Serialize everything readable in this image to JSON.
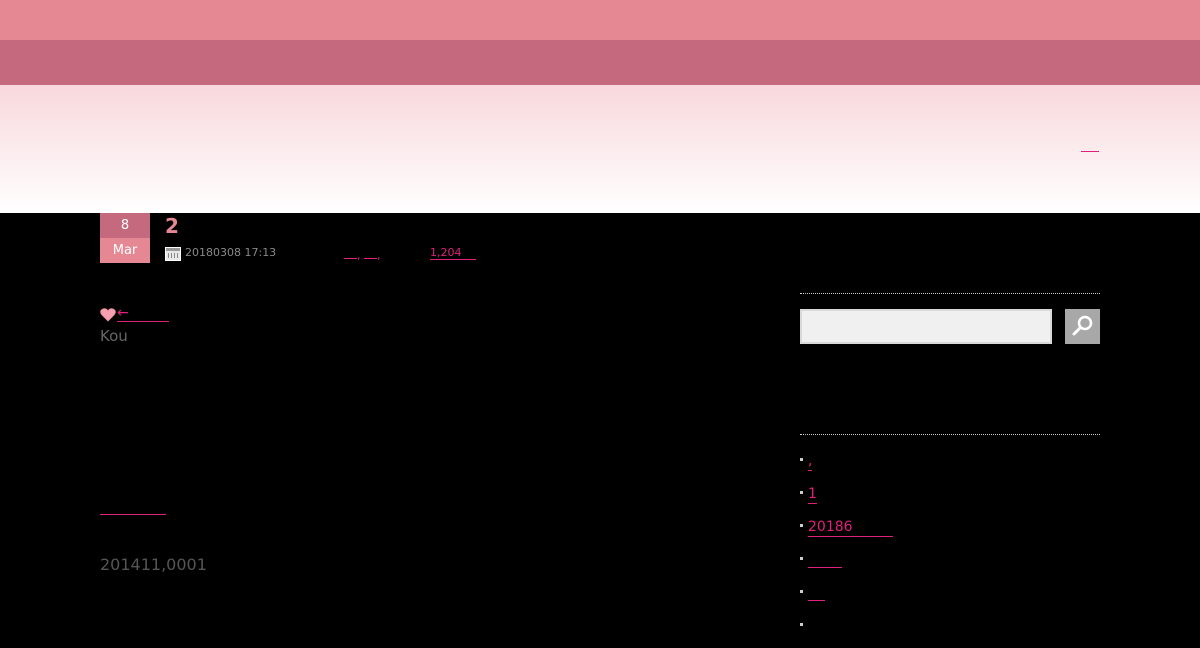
{
  "header": {
    "hero_link": ""
  },
  "post": {
    "day": "8",
    "month": "Mar",
    "title": "2",
    "date": "20180308 17:13",
    "categories": [
      "",
      ""
    ],
    "views": "1,204",
    "back_link": "←",
    "author": "Kou",
    "body_link": "",
    "footer_number": "201411,0001"
  },
  "sidebar": {
    "search": {
      "placeholder": "",
      "value": ""
    },
    "links": [
      ",",
      "1",
      "20186",
      "",
      "",
      ""
    ]
  },
  "colors": {
    "topbar": "#e68894",
    "navbar": "#c5697f",
    "accent_link": "#e0207a",
    "background": "#000000"
  },
  "icons": {
    "date": "calendar-icon",
    "back": "heart-icon",
    "search": "search-icon"
  }
}
